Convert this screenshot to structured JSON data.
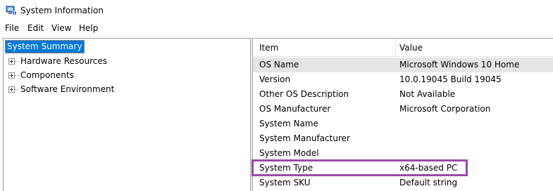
{
  "window": {
    "title": "System Information",
    "icon": "system-information-icon"
  },
  "menu": {
    "items": [
      "File",
      "Edit",
      "View",
      "Help"
    ]
  },
  "tree": {
    "root_label": "System Summary",
    "children": [
      {
        "label": "Hardware Resources",
        "expander": "plus"
      },
      {
        "label": "Components",
        "expander": "plus"
      },
      {
        "label": "Software Environment",
        "expander": "plus"
      }
    ]
  },
  "list": {
    "headers": {
      "item": "Item",
      "value": "Value"
    },
    "rows": [
      {
        "item": "OS Name",
        "value": "Microsoft Windows 10 Home"
      },
      {
        "item": "Version",
        "value": "10.0.19045 Build 19045"
      },
      {
        "item": "Other OS Description",
        "value": "Not Available"
      },
      {
        "item": "OS Manufacturer",
        "value": "Microsoft Corporation"
      },
      {
        "item": "System Name",
        "value": ""
      },
      {
        "item": "System Manufacturer",
        "value": ""
      },
      {
        "item": "System Model",
        "value": ""
      },
      {
        "item": "System Type",
        "value": "x64-based PC"
      },
      {
        "item": "System SKU",
        "value": "Default string"
      }
    ]
  },
  "colors": {
    "selection": "#0078d7",
    "highlight_box": "#9a4aa8"
  }
}
